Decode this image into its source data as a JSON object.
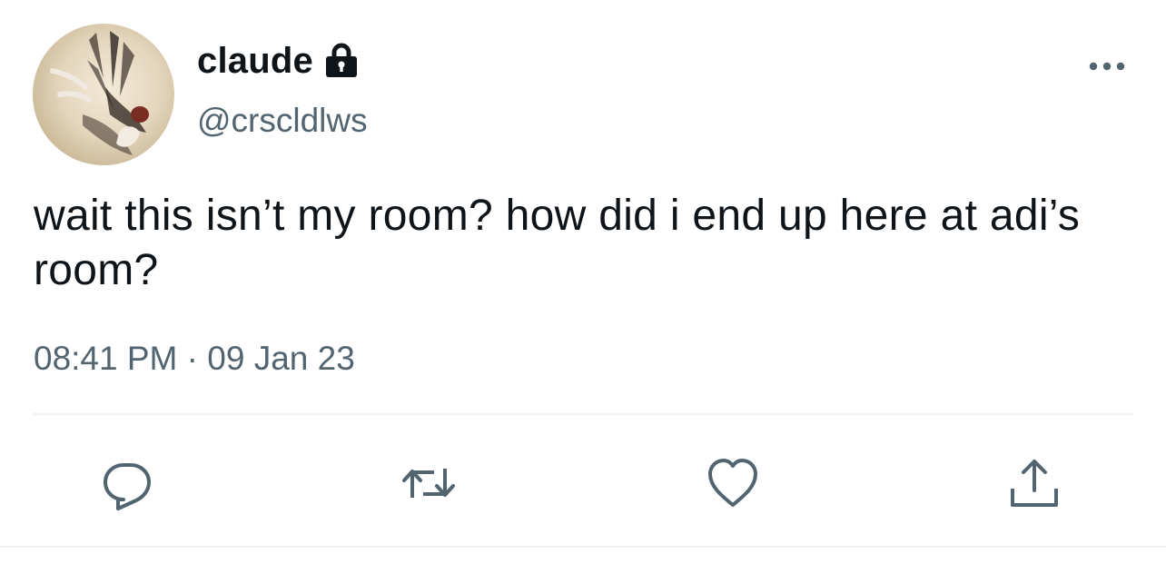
{
  "author": {
    "display_name": "claude",
    "handle": "@crscldlws",
    "protected": true,
    "avatar_icon": "avatar-illustration",
    "lock_icon": "lock-icon"
  },
  "tweet": {
    "text": "wait this isn’t my room? how did i end up here at adi’s room?",
    "time": "08:41 PM",
    "separator": "·",
    "date": "09 Jan 23"
  },
  "actions": {
    "reply_icon": "reply-icon",
    "retweet_icon": "retweet-icon",
    "like_icon": "heart-icon",
    "share_icon": "share-icon",
    "more_icon": "more-icon"
  },
  "colors": {
    "text": "#0f1419",
    "secondary": "#536471",
    "divider": "#eff3f4"
  }
}
